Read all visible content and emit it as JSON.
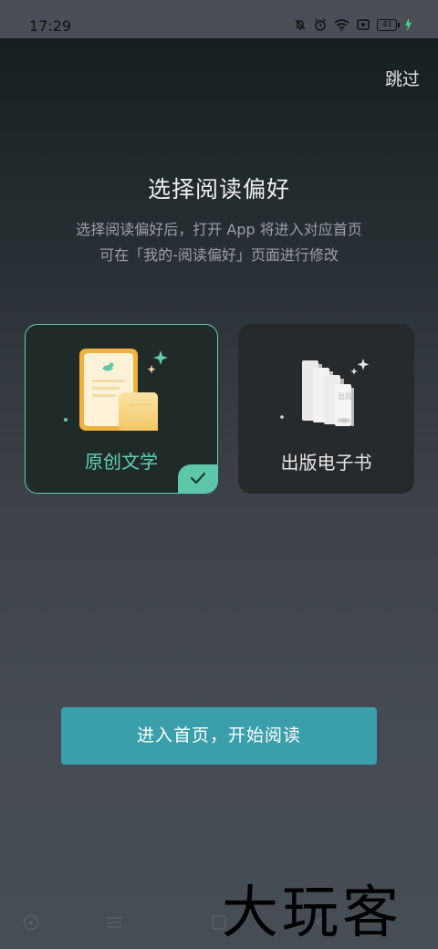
{
  "status_bar": {
    "time": "17:29",
    "battery": "43",
    "icons": [
      "mute-bell-icon",
      "alarm-icon",
      "wifi-icon",
      "screen-record-icon",
      "battery-icon",
      "charging-icon"
    ]
  },
  "skip_label": "跳过",
  "title": "选择阅读偏好",
  "subtitle_line1": "选择阅读偏好后，打开 App 将进入对应首页",
  "subtitle_line2": "可在「我的-阅读偏好」页面进行修改",
  "options": [
    {
      "label": "原创文学",
      "selected": true,
      "icon": "document-bird-icon"
    },
    {
      "label": "出版电子书",
      "selected": false,
      "icon": "book-stack-icon"
    }
  ],
  "enter_button": "进入首页，开始阅读",
  "nav": [
    "home-icon",
    "menu-icon",
    "recents-icon",
    "back-icon"
  ],
  "watermark": "大玩客",
  "colors": {
    "accent": "#5fd0b0",
    "button": "#3a9faa",
    "background": "#3d4349"
  }
}
